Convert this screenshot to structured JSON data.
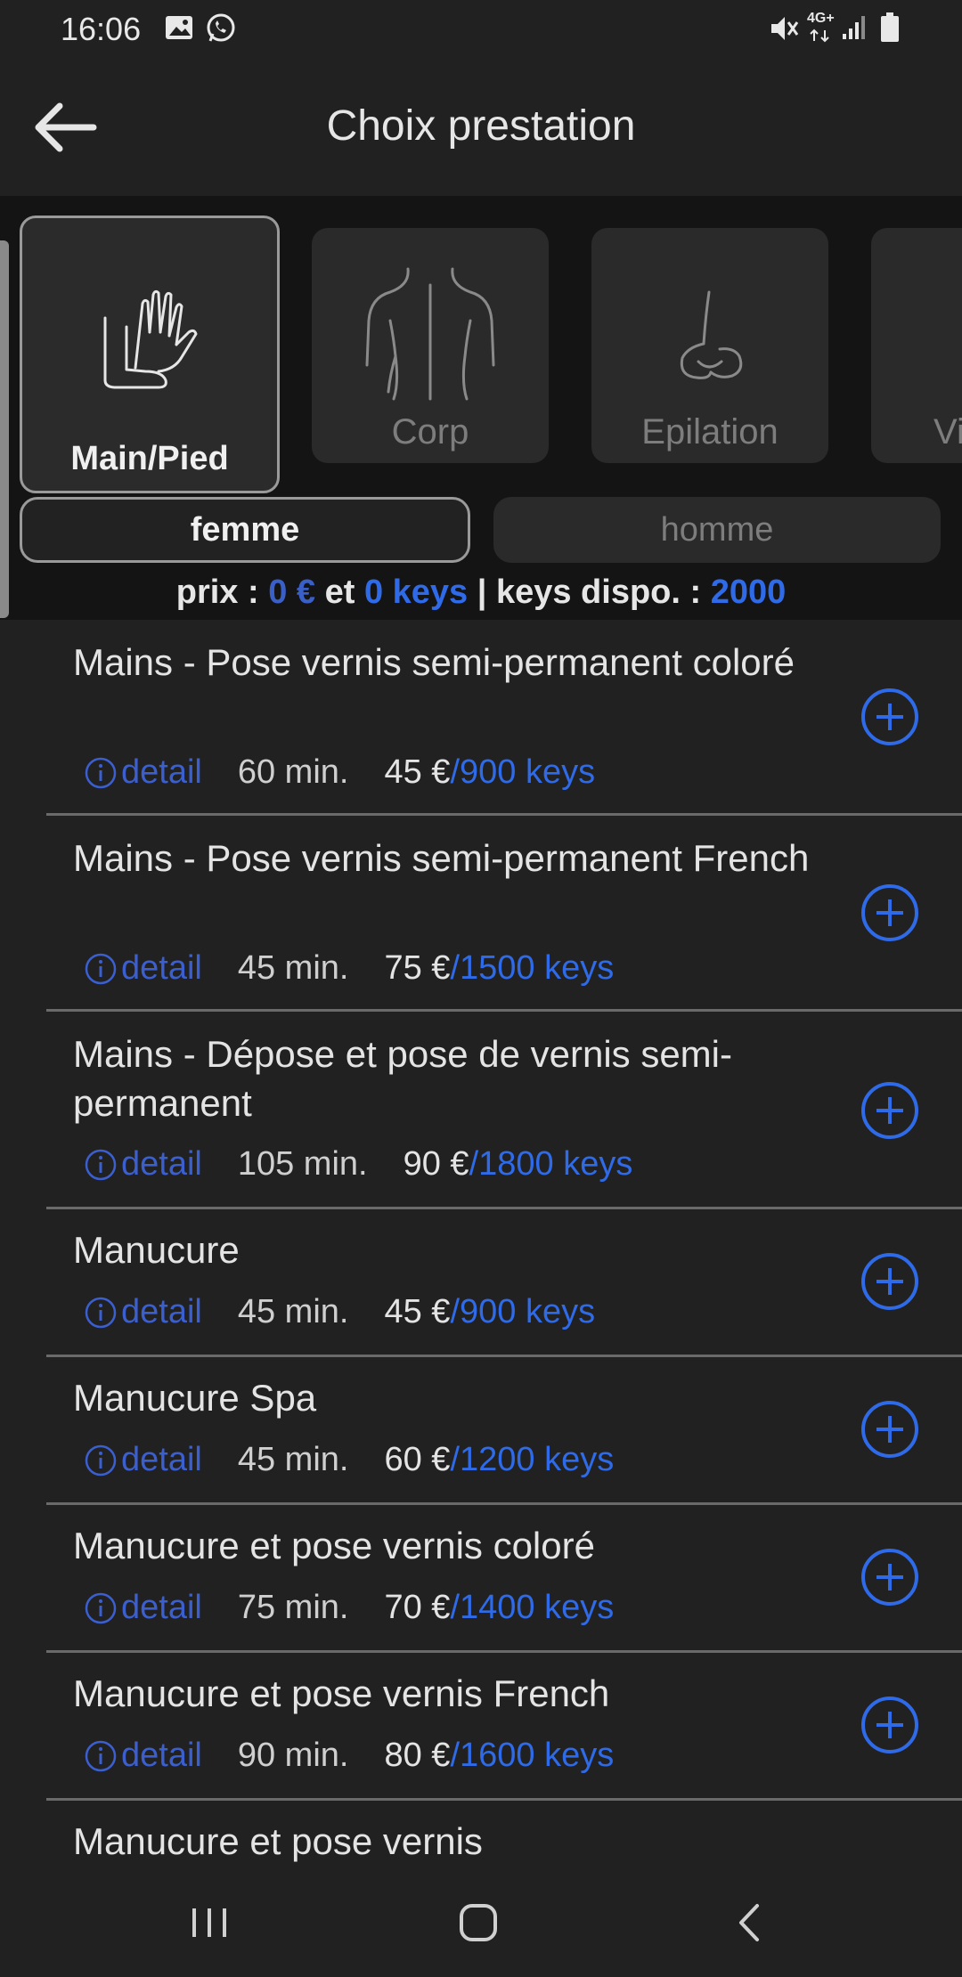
{
  "status": {
    "time": "16:06",
    "network": "4G+"
  },
  "header": {
    "title": "Choix prestation"
  },
  "categories": [
    {
      "label": "Main/Pied",
      "icon": "hand-foot-icon",
      "active": true
    },
    {
      "label": "Corp",
      "icon": "body-icon",
      "active": false
    },
    {
      "label": "Epilation",
      "icon": "nose-icon",
      "active": false
    },
    {
      "label": "Vi",
      "icon": "face-icon",
      "active": false
    }
  ],
  "gender": {
    "femme": "femme",
    "homme": "homme",
    "selected": "femme"
  },
  "summary": {
    "prix_label": "prix :",
    "prix_value": "0 €",
    "et": "et",
    "keys_value": "0 keys",
    "separator": "|",
    "dispo_label": "keys dispo. :",
    "dispo_value": "2000"
  },
  "services": [
    {
      "title": "Mains - Pose vernis semi-permanent coloré",
      "detail": "detail",
      "duration": "60 min.",
      "price": "45 €",
      "keys": "/900 keys"
    },
    {
      "title": "Mains - Pose vernis semi-permanent French",
      "detail": "detail",
      "duration": "45 min.",
      "price": "75 €",
      "keys": "/1500 keys"
    },
    {
      "title": "Mains - Dépose et pose de vernis semi-permanent",
      "detail": "detail",
      "duration": "105 min.",
      "price": "90 €",
      "keys": "/1800 keys"
    },
    {
      "title": "Manucure",
      "detail": "detail",
      "duration": "45 min.",
      "price": "45 €",
      "keys": "/900 keys"
    },
    {
      "title": "Manucure Spa",
      "detail": "detail",
      "duration": "45 min.",
      "price": "60 €",
      "keys": "/1200 keys"
    },
    {
      "title": "Manucure et pose vernis coloré",
      "detail": "detail",
      "duration": "75 min.",
      "price": "70 €",
      "keys": "/1400 keys"
    },
    {
      "title": "Manucure et pose vernis French",
      "detail": "detail",
      "duration": "90 min.",
      "price": "80 €",
      "keys": "/1600 keys"
    },
    {
      "title": "Manucure et pose vernis"
    }
  ],
  "colors": {
    "accent": "#2f6be8",
    "background": "#212121",
    "panel": "#141414"
  }
}
